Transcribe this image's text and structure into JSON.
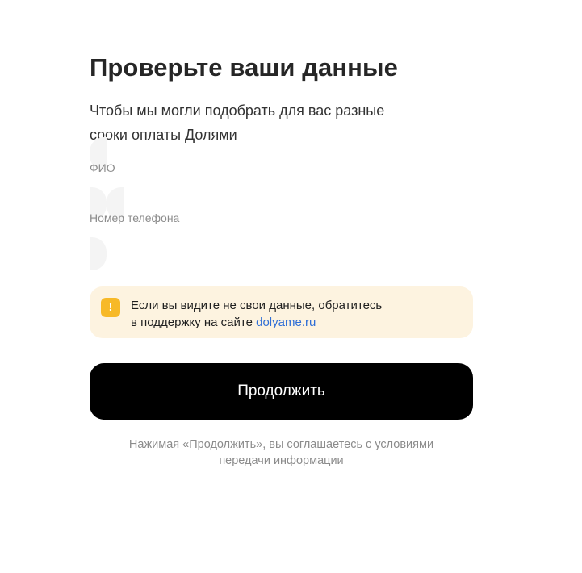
{
  "form": {
    "title": "Проверьте ваши данные",
    "subtitle_line1": "Чтобы мы могли подобрать для вас разные",
    "subtitle_line2": "сроки оплаты Долями",
    "fields": [
      {
        "label": "ФИО",
        "value": ""
      },
      {
        "label": "Номер телефона",
        "value": ""
      }
    ]
  },
  "notice": {
    "icon": "exclamation-icon",
    "icon_glyph": "!",
    "icon_color": "#f7b928",
    "background": "#fdf3e0",
    "line1": "Если вы видите не свои данные, обратитесь",
    "line2_prefix": "в поддержку на сайте ",
    "link_text": "dolyame.ru",
    "link_color": "#2f6ed6"
  },
  "actions": {
    "continue_label": "Продолжить"
  },
  "terms": {
    "prefix": "Нажимая «Продолжить», вы соглашаетесь с ",
    "link_part1": "условиями",
    "link_part2": "передачи информации"
  }
}
